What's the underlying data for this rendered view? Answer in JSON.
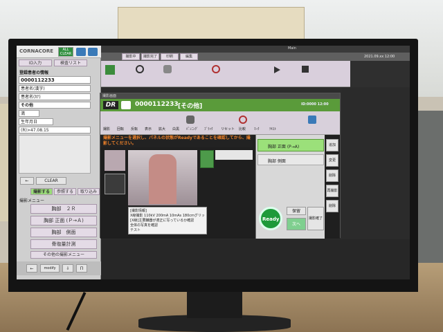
{
  "left_panel": {
    "logo": "CORNACORE",
    "all_clear": "ALL CLEAR",
    "tab_id_input": "ID入力",
    "tab_exam_list": "検査リスト",
    "patient_info_heading": "登録患者の情報",
    "patient_id": "0000112233",
    "name_kanji": "患者名(漢字)",
    "name_kana": "患者名(ｶﾅ)",
    "gender_value": "その他",
    "age": "満",
    "birth_label": "生年月日",
    "birth_value": "(R)>47.08.15",
    "clear_button": "CLEAR",
    "tab_shoot": "撮影する",
    "tab_referral": "参照する",
    "tab_history": "取り込み",
    "menu_title": "撮影メニュー",
    "menu_items": [
      "胸部　２Ｒ",
      "胸部 正面 (Ｐ→Ａ)",
      "胸部　側面",
      "骨塩量計測",
      "その他の撮影メニュー"
    ],
    "bottom_buttons": [
      "←",
      "modify",
      "⇩",
      "Π"
    ]
  },
  "main": {
    "tab_labels": [
      "撮影中",
      "撮影完了",
      "印刷",
      "編集"
    ],
    "top_header": "Main",
    "clock_top": "2021.09.xx 12:00"
  },
  "dialog": {
    "window_title": "撮影画面",
    "dr_badge": "DR",
    "patient_id": "0000112233",
    "category": "[その他]",
    "status_time": "ID:0000 12:00",
    "instruction": "撮影メニューを選択し、パネルの状態がReadyであることを確認してから、撮影してください。",
    "notes_title": "[撮影情報]",
    "notes_lines": [
      "X線撮影 110kV 200mA 10mAs 180cmグリッドあり",
      "[X線]主要臓器が適正に写っているか確認",
      "全体の写真を確認",
      "テスト"
    ],
    "menu_items": [
      {
        "label": "胸部 正面 (P→A)",
        "selected": true
      },
      {
        "label": "胸部 側面",
        "selected": false
      }
    ],
    "ready_label": "Ready",
    "hold_label": "保留",
    "confirm_label": "撮影確了",
    "next_label": "次へ",
    "side_buttons": [
      "追加",
      "変更",
      "削除",
      "再撮影",
      "削除"
    ],
    "toolbar_labels": [
      "撮影",
      "回転",
      "反転",
      "表示",
      "拡大",
      "白黒",
      "ﾊﾟﾝﾆﾝｸﾞ",
      "ﾌﾞﾗｯｸ",
      "リセット",
      "比較",
      "ﾏｰｸ",
      "ﾃｷｽﾄ"
    ]
  },
  "colors": {
    "accent_green": "#5a9b3a",
    "ready_green": "#1d9a3a",
    "instruction_orange": "#e57a16",
    "selected_item": "#9be07a"
  }
}
